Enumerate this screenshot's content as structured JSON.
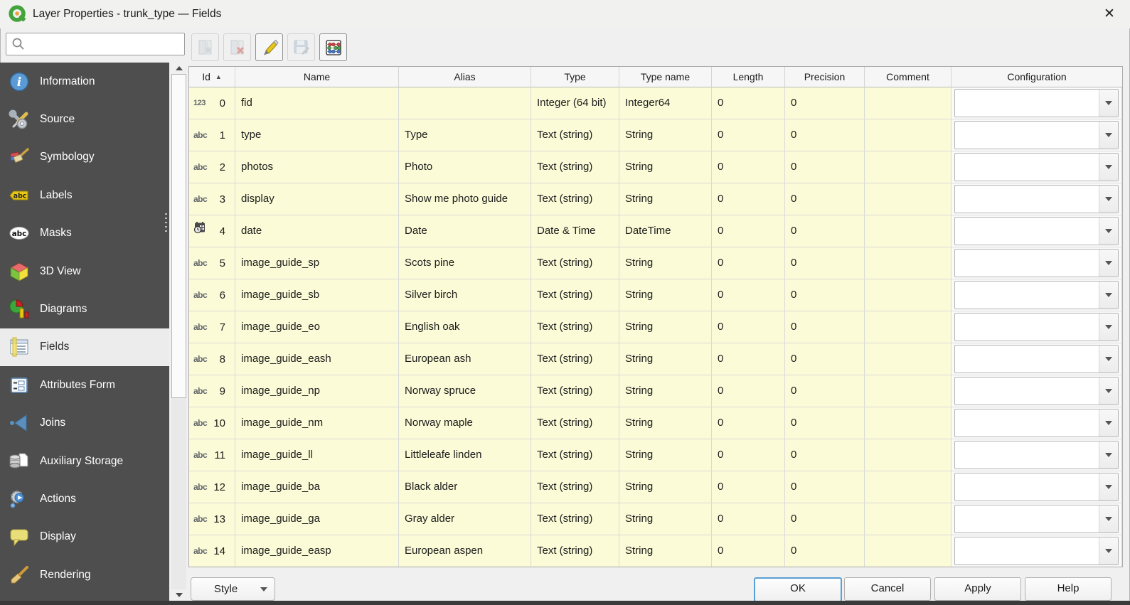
{
  "window": {
    "title": "Layer Properties - trunk_type — Fields",
    "close_glyph": "✕"
  },
  "toolbar": {
    "search_placeholder": "",
    "search_value": "",
    "buttons": [
      {
        "icon": "add-field-icon",
        "enabled": false
      },
      {
        "icon": "delete-field-icon",
        "enabled": false
      },
      {
        "icon": "toggle-editing-icon",
        "enabled": true
      },
      {
        "icon": "save-edits-icon",
        "enabled": false
      },
      {
        "icon": "field-calculator-icon",
        "enabled": true
      }
    ]
  },
  "sidebar": {
    "items": [
      {
        "label": "Information",
        "selected": false
      },
      {
        "label": "Source",
        "selected": false
      },
      {
        "label": "Symbology",
        "selected": false
      },
      {
        "label": "Labels",
        "selected": false
      },
      {
        "label": "Masks",
        "selected": false
      },
      {
        "label": "3D View",
        "selected": false
      },
      {
        "label": "Diagrams",
        "selected": false
      },
      {
        "label": "Fields",
        "selected": true
      },
      {
        "label": "Attributes Form",
        "selected": false
      },
      {
        "label": "Joins",
        "selected": false
      },
      {
        "label": "Auxiliary Storage",
        "selected": false
      },
      {
        "label": "Actions",
        "selected": false
      },
      {
        "label": "Display",
        "selected": false
      },
      {
        "label": "Rendering",
        "selected": false
      }
    ]
  },
  "fields_table": {
    "columns": [
      "Id",
      "Name",
      "Alias",
      "Type",
      "Type name",
      "Length",
      "Precision",
      "Comment",
      "Configuration"
    ],
    "sort_column": "Id",
    "sort_order": "ascending",
    "rows": [
      {
        "icon": "123",
        "id": "0",
        "name": "fid",
        "alias": "",
        "type": "Integer (64 bit)",
        "type_name": "Integer64",
        "length": "0",
        "precision": "0",
        "comment": "",
        "configuration": ""
      },
      {
        "icon": "abc",
        "id": "1",
        "name": "type",
        "alias": "Type",
        "type": "Text (string)",
        "type_name": "String",
        "length": "0",
        "precision": "0",
        "comment": "",
        "configuration": ""
      },
      {
        "icon": "abc",
        "id": "2",
        "name": "photos",
        "alias": "Photo",
        "type": "Text (string)",
        "type_name": "String",
        "length": "0",
        "precision": "0",
        "comment": "",
        "configuration": ""
      },
      {
        "icon": "abc",
        "id": "3",
        "name": "display",
        "alias": "Show me photo guide",
        "type": "Text (string)",
        "type_name": "String",
        "length": "0",
        "precision": "0",
        "comment": "",
        "configuration": ""
      },
      {
        "icon": "date",
        "id": "4",
        "name": "date",
        "alias": "Date",
        "type": "Date & Time",
        "type_name": "DateTime",
        "length": "0",
        "precision": "0",
        "comment": "",
        "configuration": ""
      },
      {
        "icon": "abc",
        "id": "5",
        "name": "image_guide_sp",
        "alias": "Scots pine",
        "type": "Text (string)",
        "type_name": "String",
        "length": "0",
        "precision": "0",
        "comment": "",
        "configuration": ""
      },
      {
        "icon": "abc",
        "id": "6",
        "name": "image_guide_sb",
        "alias": "Silver birch",
        "type": "Text (string)",
        "type_name": "String",
        "length": "0",
        "precision": "0",
        "comment": "",
        "configuration": ""
      },
      {
        "icon": "abc",
        "id": "7",
        "name": "image_guide_eo",
        "alias": "English oak",
        "type": "Text (string)",
        "type_name": "String",
        "length": "0",
        "precision": "0",
        "comment": "",
        "configuration": ""
      },
      {
        "icon": "abc",
        "id": "8",
        "name": "image_guide_eash",
        "alias": "European ash",
        "type": "Text (string)",
        "type_name": "String",
        "length": "0",
        "precision": "0",
        "comment": "",
        "configuration": ""
      },
      {
        "icon": "abc",
        "id": "9",
        "name": "image_guide_np",
        "alias": "Norway spruce",
        "type": "Text (string)",
        "type_name": "String",
        "length": "0",
        "precision": "0",
        "comment": "",
        "configuration": ""
      },
      {
        "icon": "abc",
        "id": "10",
        "name": "image_guide_nm",
        "alias": "Norway maple",
        "type": "Text (string)",
        "type_name": "String",
        "length": "0",
        "precision": "0",
        "comment": "",
        "configuration": ""
      },
      {
        "icon": "abc",
        "id": "11",
        "name": "image_guide_ll",
        "alias": "Littleleafe linden",
        "type": "Text (string)",
        "type_name": "String",
        "length": "0",
        "precision": "0",
        "comment": "",
        "configuration": ""
      },
      {
        "icon": "abc",
        "id": "12",
        "name": "image_guide_ba",
        "alias": "Black alder",
        "type": "Text (string)",
        "type_name": "String",
        "length": "0",
        "precision": "0",
        "comment": "",
        "configuration": ""
      },
      {
        "icon": "abc",
        "id": "13",
        "name": "image_guide_ga",
        "alias": "Gray alder",
        "type": "Text (string)",
        "type_name": "String",
        "length": "0",
        "precision": "0",
        "comment": "",
        "configuration": ""
      },
      {
        "icon": "abc",
        "id": "14",
        "name": "image_guide_easp",
        "alias": "European aspen",
        "type": "Text (string)",
        "type_name": "String",
        "length": "0",
        "precision": "0",
        "comment": "",
        "configuration": ""
      }
    ]
  },
  "footer": {
    "style_label": "Style",
    "ok_label": "OK",
    "cancel_label": "Cancel",
    "apply_label": "Apply",
    "help_label": "Help"
  },
  "colors": {
    "row_background": "#fbfbd7",
    "sidebar_background": "#4e4e4e",
    "selected_item_background": "#ececec",
    "default_button_border": "#5a9fd4",
    "grid_line": "#dadada"
  }
}
